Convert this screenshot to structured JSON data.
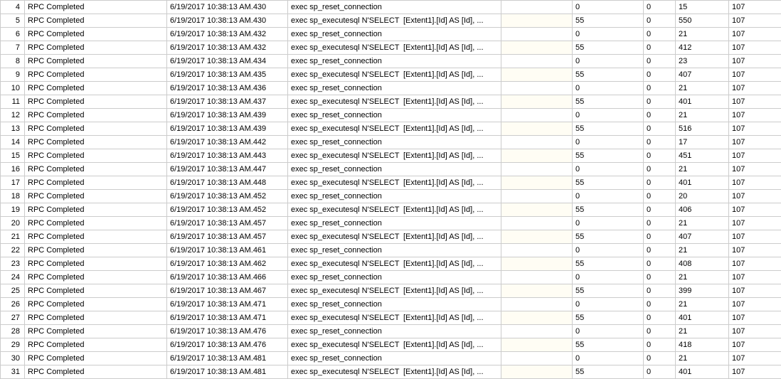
{
  "sql": {
    "reset": "exec sp_reset_connection",
    "exec_prefix": "exec sp_executesql N'SELECT",
    "exec_suffix": "[Extent1].[Id] AS [Id],   ..."
  },
  "rows": [
    {
      "n": "4",
      "event": "RPC Completed",
      "time": "6/19/2017 10:38:13 AM.430",
      "kind": "reset",
      "hl": false,
      "c1": "0",
      "c2": "0",
      "c3": "15",
      "c4": "107"
    },
    {
      "n": "5",
      "event": "RPC Completed",
      "time": "6/19/2017 10:38:13 AM.430",
      "kind": "exec",
      "hl": true,
      "c1": "55",
      "c2": "0",
      "c3": "550",
      "c4": "107"
    },
    {
      "n": "6",
      "event": "RPC Completed",
      "time": "6/19/2017 10:38:13 AM.432",
      "kind": "reset",
      "hl": false,
      "c1": "0",
      "c2": "0",
      "c3": "21",
      "c4": "107"
    },
    {
      "n": "7",
      "event": "RPC Completed",
      "time": "6/19/2017 10:38:13 AM.432",
      "kind": "exec",
      "hl": true,
      "c1": "55",
      "c2": "0",
      "c3": "412",
      "c4": "107"
    },
    {
      "n": "8",
      "event": "RPC Completed",
      "time": "6/19/2017 10:38:13 AM.434",
      "kind": "reset",
      "hl": false,
      "c1": "0",
      "c2": "0",
      "c3": "23",
      "c4": "107"
    },
    {
      "n": "9",
      "event": "RPC Completed",
      "time": "6/19/2017 10:38:13 AM.435",
      "kind": "exec",
      "hl": true,
      "c1": "55",
      "c2": "0",
      "c3": "407",
      "c4": "107"
    },
    {
      "n": "10",
      "event": "RPC Completed",
      "time": "6/19/2017 10:38:13 AM.436",
      "kind": "reset",
      "hl": false,
      "c1": "0",
      "c2": "0",
      "c3": "21",
      "c4": "107"
    },
    {
      "n": "11",
      "event": "RPC Completed",
      "time": "6/19/2017 10:38:13 AM.437",
      "kind": "exec",
      "hl": true,
      "c1": "55",
      "c2": "0",
      "c3": "401",
      "c4": "107"
    },
    {
      "n": "12",
      "event": "RPC Completed",
      "time": "6/19/2017 10:38:13 AM.439",
      "kind": "reset",
      "hl": false,
      "c1": "0",
      "c2": "0",
      "c3": "21",
      "c4": "107"
    },
    {
      "n": "13",
      "event": "RPC Completed",
      "time": "6/19/2017 10:38:13 AM.439",
      "kind": "exec",
      "hl": true,
      "c1": "55",
      "c2": "0",
      "c3": "516",
      "c4": "107"
    },
    {
      "n": "14",
      "event": "RPC Completed",
      "time": "6/19/2017 10:38:13 AM.442",
      "kind": "reset",
      "hl": false,
      "c1": "0",
      "c2": "0",
      "c3": "17",
      "c4": "107"
    },
    {
      "n": "15",
      "event": "RPC Completed",
      "time": "6/19/2017 10:38:13 AM.443",
      "kind": "exec",
      "hl": true,
      "c1": "55",
      "c2": "0",
      "c3": "451",
      "c4": "107"
    },
    {
      "n": "16",
      "event": "RPC Completed",
      "time": "6/19/2017 10:38:13 AM.447",
      "kind": "reset",
      "hl": false,
      "c1": "0",
      "c2": "0",
      "c3": "21",
      "c4": "107"
    },
    {
      "n": "17",
      "event": "RPC Completed",
      "time": "6/19/2017 10:38:13 AM.448",
      "kind": "exec",
      "hl": true,
      "c1": "55",
      "c2": "0",
      "c3": "401",
      "c4": "107"
    },
    {
      "n": "18",
      "event": "RPC Completed",
      "time": "6/19/2017 10:38:13 AM.452",
      "kind": "reset",
      "hl": false,
      "c1": "0",
      "c2": "0",
      "c3": "20",
      "c4": "107"
    },
    {
      "n": "19",
      "event": "RPC Completed",
      "time": "6/19/2017 10:38:13 AM.452",
      "kind": "exec",
      "hl": true,
      "c1": "55",
      "c2": "0",
      "c3": "406",
      "c4": "107"
    },
    {
      "n": "20",
      "event": "RPC Completed",
      "time": "6/19/2017 10:38:13 AM.457",
      "kind": "reset",
      "hl": false,
      "c1": "0",
      "c2": "0",
      "c3": "21",
      "c4": "107"
    },
    {
      "n": "21",
      "event": "RPC Completed",
      "time": "6/19/2017 10:38:13 AM.457",
      "kind": "exec",
      "hl": true,
      "c1": "55",
      "c2": "0",
      "c3": "407",
      "c4": "107"
    },
    {
      "n": "22",
      "event": "RPC Completed",
      "time": "6/19/2017 10:38:13 AM.461",
      "kind": "reset",
      "hl": false,
      "c1": "0",
      "c2": "0",
      "c3": "21",
      "c4": "107"
    },
    {
      "n": "23",
      "event": "RPC Completed",
      "time": "6/19/2017 10:38:13 AM.462",
      "kind": "exec",
      "hl": true,
      "c1": "55",
      "c2": "0",
      "c3": "408",
      "c4": "107"
    },
    {
      "n": "24",
      "event": "RPC Completed",
      "time": "6/19/2017 10:38:13 AM.466",
      "kind": "reset",
      "hl": false,
      "c1": "0",
      "c2": "0",
      "c3": "21",
      "c4": "107"
    },
    {
      "n": "25",
      "event": "RPC Completed",
      "time": "6/19/2017 10:38:13 AM.467",
      "kind": "exec",
      "hl": true,
      "c1": "55",
      "c2": "0",
      "c3": "399",
      "c4": "107"
    },
    {
      "n": "26",
      "event": "RPC Completed",
      "time": "6/19/2017 10:38:13 AM.471",
      "kind": "reset",
      "hl": false,
      "c1": "0",
      "c2": "0",
      "c3": "21",
      "c4": "107"
    },
    {
      "n": "27",
      "event": "RPC Completed",
      "time": "6/19/2017 10:38:13 AM.471",
      "kind": "exec",
      "hl": true,
      "c1": "55",
      "c2": "0",
      "c3": "401",
      "c4": "107"
    },
    {
      "n": "28",
      "event": "RPC Completed",
      "time": "6/19/2017 10:38:13 AM.476",
      "kind": "reset",
      "hl": false,
      "c1": "0",
      "c2": "0",
      "c3": "21",
      "c4": "107"
    },
    {
      "n": "29",
      "event": "RPC Completed",
      "time": "6/19/2017 10:38:13 AM.476",
      "kind": "exec",
      "hl": true,
      "c1": "55",
      "c2": "0",
      "c3": "418",
      "c4": "107"
    },
    {
      "n": "30",
      "event": "RPC Completed",
      "time": "6/19/2017 10:38:13 AM.481",
      "kind": "reset",
      "hl": false,
      "c1": "0",
      "c2": "0",
      "c3": "21",
      "c4": "107"
    },
    {
      "n": "31",
      "event": "RPC Completed",
      "time": "6/19/2017 10:38:13 AM.481",
      "kind": "exec",
      "hl": true,
      "c1": "55",
      "c2": "0",
      "c3": "401",
      "c4": "107"
    }
  ]
}
